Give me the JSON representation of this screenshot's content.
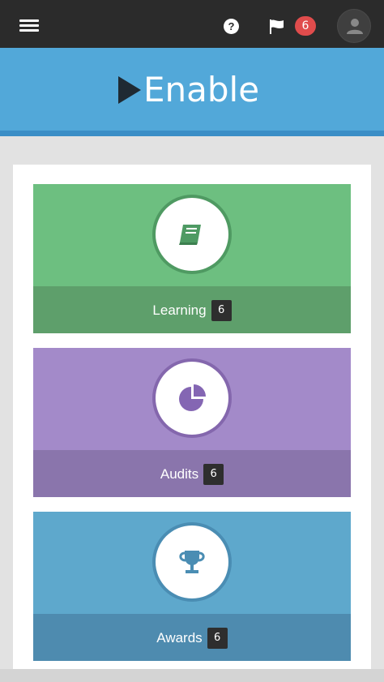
{
  "header": {
    "help_glyph": "?",
    "notification_count": "6"
  },
  "brand": {
    "name": "Enable"
  },
  "tiles": [
    {
      "label": "Learning",
      "count": "6",
      "icon": "book-icon"
    },
    {
      "label": "Audits",
      "count": "6",
      "icon": "pie-chart-icon"
    },
    {
      "label": "Awards",
      "count": "6",
      "icon": "trophy-icon"
    }
  ],
  "colors": {
    "topbar": "#2b2b2b",
    "brand_blue": "#52a8d9",
    "learning_top": "#6dbf80",
    "learning_bottom": "#5e9f6b",
    "audits_top": "#a38ac9",
    "audits_bottom": "#8a75ac",
    "awards_top": "#5ea8cc",
    "awards_bottom": "#4e8baf",
    "badge_red": "#e04c4c"
  }
}
